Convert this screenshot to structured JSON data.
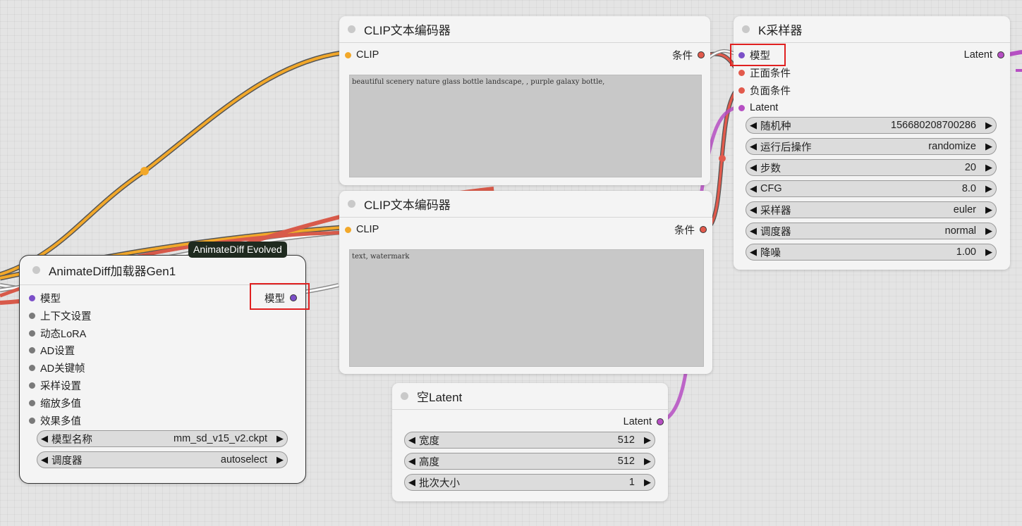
{
  "colors": {
    "model": "#7b4fc8",
    "clip": "#f2a82a",
    "conditioning": "#e25a4c",
    "latent": "#b64fc3",
    "generic": "#7a7a7a",
    "highlight": "#e02020"
  },
  "clip_node_1": {
    "title": "CLIP文本编码器",
    "input_clip": "CLIP",
    "output_cond": "条件",
    "text": "beautiful scenery nature glass bottle landscape, , purple galaxy bottle,"
  },
  "clip_node_2": {
    "title": "CLIP文本编码器",
    "input_clip": "CLIP",
    "output_cond": "条件",
    "text": "text, watermark"
  },
  "ksampler": {
    "title": "K采样器",
    "inputs": [
      "模型",
      "正面条件",
      "负面条件",
      "Latent"
    ],
    "output_latent": "Latent",
    "widgets": [
      {
        "label": "随机种",
        "value": "156680208700286"
      },
      {
        "label": "运行后操作",
        "value": "randomize"
      },
      {
        "label": "步数",
        "value": "20"
      },
      {
        "label": "CFG",
        "value": "8.0"
      },
      {
        "label": "采样器",
        "value": "euler"
      },
      {
        "label": "调度器",
        "value": "normal"
      },
      {
        "label": "降噪",
        "value": "1.00"
      }
    ]
  },
  "animatediff": {
    "badge": "AnimateDiff Evolved",
    "title": "AnimateDiff加载器Gen1",
    "output_model": "模型",
    "inputs": [
      "模型",
      "上下文设置",
      "动态LoRA",
      "AD设置",
      "AD关键帧",
      "采样设置",
      "缩放多值",
      "效果多值"
    ],
    "widgets": [
      {
        "label": "模型名称",
        "value": "mm_sd_v15_v2.ckpt"
      },
      {
        "label": "调度器",
        "value": "autoselect"
      }
    ]
  },
  "empty_latent": {
    "title": "空Latent",
    "output_latent": "Latent",
    "widgets": [
      {
        "label": "宽度",
        "value": "512"
      },
      {
        "label": "高度",
        "value": "512"
      },
      {
        "label": "批次大小",
        "value": "1"
      }
    ]
  },
  "widget_arrows": {
    "left": "◀",
    "right": "▶"
  }
}
